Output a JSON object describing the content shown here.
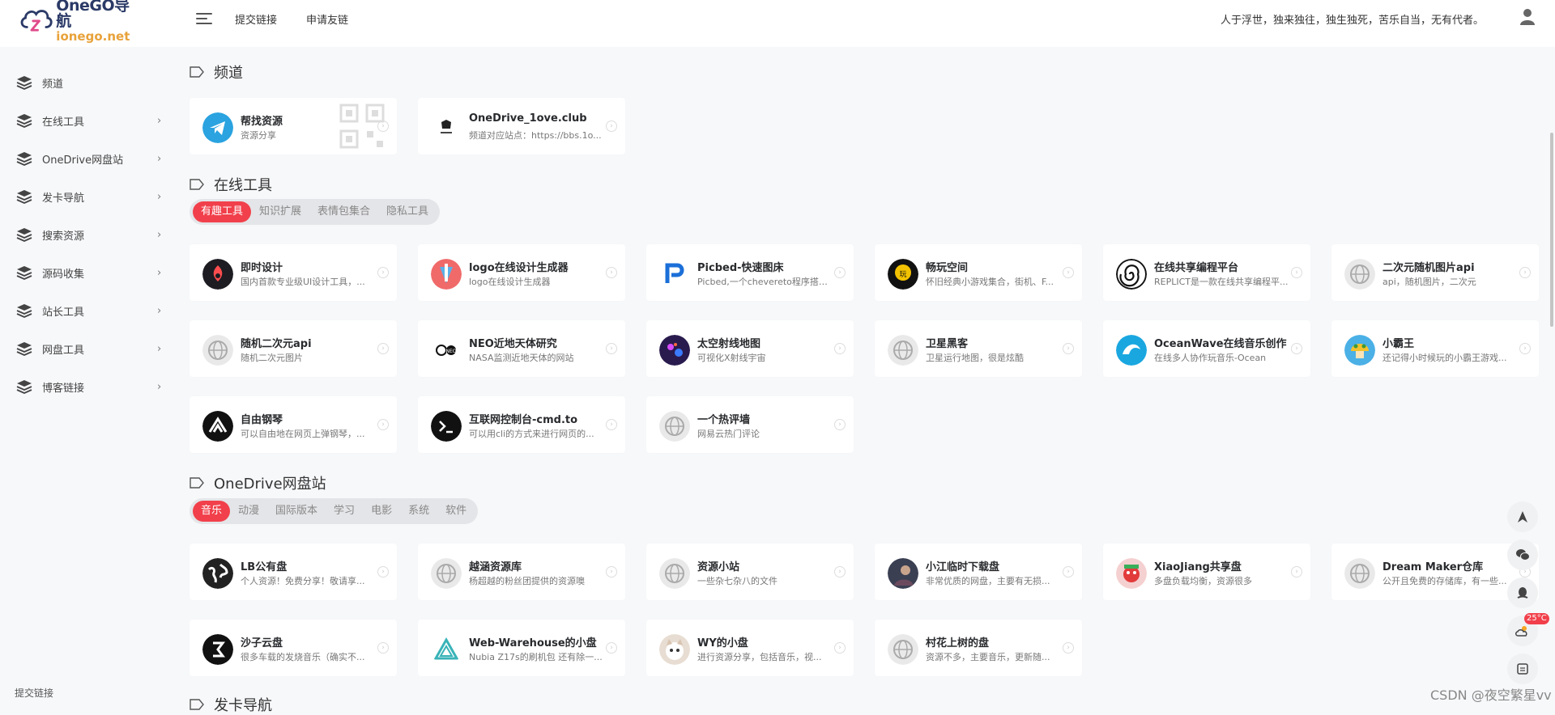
{
  "brand": {
    "logo_line1": "OneGO导航",
    "logo_line2": "ionego.net",
    "colors": {
      "primary_line": "#2b3a67",
      "secondary_line": "#e8a23a"
    }
  },
  "header": {
    "links": [
      "提交链接",
      "申请友链"
    ],
    "motto": "人于浮世，独来独往，独生独死，苦乐自当，无有代者。"
  },
  "sidebar": {
    "items": [
      {
        "label": "频道",
        "has_submenu": false
      },
      {
        "label": "在线工具",
        "has_submenu": true
      },
      {
        "label": "OneDrive网盘站",
        "has_submenu": true
      },
      {
        "label": "发卡导航",
        "has_submenu": true
      },
      {
        "label": "搜索资源",
        "has_submenu": true
      },
      {
        "label": "源码收集",
        "has_submenu": true
      },
      {
        "label": "站长工具",
        "has_submenu": true
      },
      {
        "label": "网盘工具",
        "has_submenu": true
      },
      {
        "label": "博客链接",
        "has_submenu": true
      }
    ],
    "bottom_link": "提交链接"
  },
  "sections": {
    "channel": {
      "title": "频道",
      "cards": [
        {
          "title": "帮找资源",
          "desc": "资源分享",
          "icon": "telegram-icon"
        },
        {
          "title": "OneDrive_1ove.club",
          "desc": "频道对应站点：https://bbs.1o...",
          "icon": "skull-logo-icon"
        }
      ]
    },
    "tools": {
      "title": "在线工具",
      "tabs": [
        "有趣工具",
        "知识扩展",
        "表情包集合",
        "隐私工具"
      ],
      "active_tab": 0,
      "cards": [
        {
          "title": "即时设计",
          "desc": "国内首款专业级UI设计工具，...",
          "icon": "js-design-icon"
        },
        {
          "title": "logo在线设计生成器",
          "desc": "logo在线设计生成器",
          "icon": "logo-maker-icon"
        },
        {
          "title": "Picbed-快速图床",
          "desc": "Picbed,一个chevereto程序搭建...",
          "icon": "picbed-icon"
        },
        {
          "title": "畅玩空间",
          "desc": "怀旧经典小游戏集合，街机、F...",
          "icon": "game-space-icon"
        },
        {
          "title": "在线共享编程平台",
          "desc": "REPLICT是一款在线共享编程平...",
          "icon": "spiral-icon"
        },
        {
          "title": "二次元随机图片api",
          "desc": "api，随机图片，二次元",
          "icon": "globe-icon"
        },
        {
          "title": "随机二次元api",
          "desc": "随机二次元图片",
          "icon": "globe-icon"
        },
        {
          "title": "NEO近地天体研究",
          "desc": "NASA监测近地天体的网站",
          "icon": "neo-icon"
        },
        {
          "title": "太空射线地图",
          "desc": "可视化X射线宇宙",
          "icon": "xray-map-icon"
        },
        {
          "title": "卫星黑客",
          "desc": "卫星运行地图，很是炫酷",
          "icon": "globe-icon"
        },
        {
          "title": "OceanWave在线音乐创作",
          "desc": "在线多人协作玩音乐-Ocean",
          "icon": "wave-icon"
        },
        {
          "title": "小霸王",
          "desc": "还记得小时候玩的小霸王游戏...",
          "icon": "mushroom-icon"
        },
        {
          "title": "自由钢琴",
          "desc": "可以自由地在网页上弹钢琴，...",
          "icon": "piano-icon"
        },
        {
          "title": "互联网控制台-cmd.to",
          "desc": "可以用cli的方式来进行网页的...",
          "icon": "terminal-icon"
        },
        {
          "title": "一个热评墙",
          "desc": "网易云热门评论",
          "icon": "globe-icon"
        }
      ]
    },
    "onedrive": {
      "title": "OneDrive网盘站",
      "tabs": [
        "音乐",
        "动漫",
        "国际版本",
        "学习",
        "电影",
        "系统",
        "软件"
      ],
      "active_tab": 0,
      "cards": [
        {
          "title": "LB公有盘",
          "desc": "个人资源！免费分享！敬请享...",
          "icon": "earth-icon"
        },
        {
          "title": "越涵资源库",
          "desc": "杨超越的粉丝团提供的资源噢",
          "icon": "globe-icon"
        },
        {
          "title": "资源小站",
          "desc": "一些杂七杂八的文件",
          "icon": "globe-icon"
        },
        {
          "title": "小江临时下载盘",
          "desc": "非常优质的网盘，主要有无损...",
          "icon": "photo-avatar-icon"
        },
        {
          "title": "XiaoJiang共享盘",
          "desc": "多盘负载均衡，资源很多",
          "icon": "cartoon-avatar-icon"
        },
        {
          "title": "Dream Maker仓库",
          "desc": "公开且免费的存储库，有一些...",
          "icon": "globe-icon"
        },
        {
          "title": "沙子云盘",
          "desc": "很多车载的发烧音乐（确实不...",
          "icon": "sand-icon"
        },
        {
          "title": "Web-Warehouse的小盘",
          "desc": "Nubia Z17s的刷机包 还有除一...",
          "icon": "triangle-logo-icon"
        },
        {
          "title": "WY的小盘",
          "desc": "进行资源分享，包括音乐，视...",
          "icon": "cat-icon"
        },
        {
          "title": "村花上树的盘",
          "desc": "资源不多，主要音乐，更新随...",
          "icon": "globe-icon"
        }
      ]
    },
    "next_section_title": "发卡导航"
  },
  "floating": {
    "weather_temp": "25°C",
    "watermark": "CSDN @夜空繁星vv"
  },
  "accent_color": "#f1404b"
}
